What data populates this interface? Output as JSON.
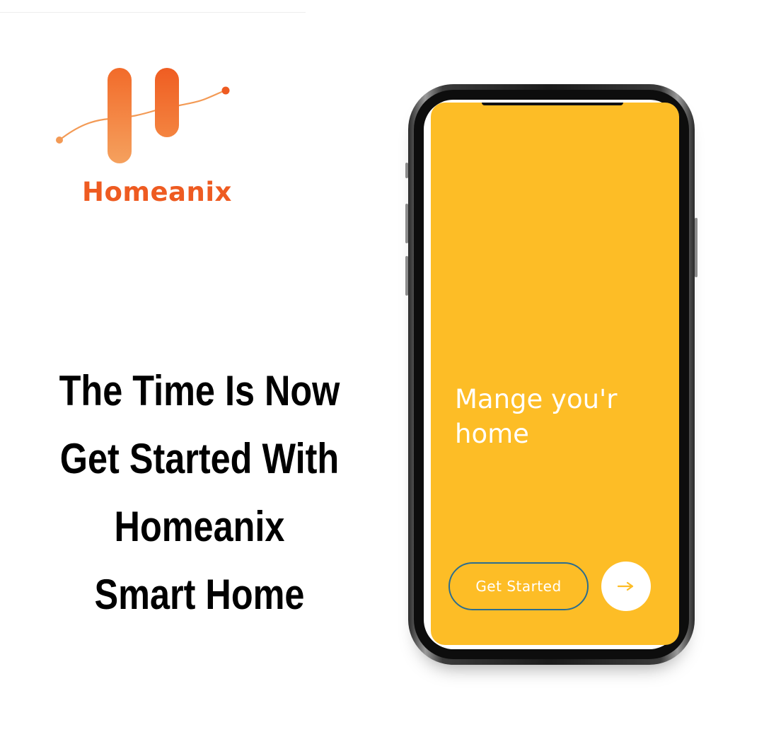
{
  "brand": {
    "name": "Homeanix",
    "logo_icon": "h-letter-graph-logo",
    "colors": {
      "primary": "#ee5b21",
      "secondary": "#f39a55"
    }
  },
  "headline": {
    "lines": [
      "The Time Is Now",
      "Get Started With",
      "Homeanix",
      "Smart Home"
    ]
  },
  "phone_screen": {
    "background_color": "#fdbd26",
    "title": "Mange you'r home",
    "get_started_label": "Get Started",
    "next_icon": "arrow-right-icon",
    "button_border_color": "#2b6d8f"
  }
}
